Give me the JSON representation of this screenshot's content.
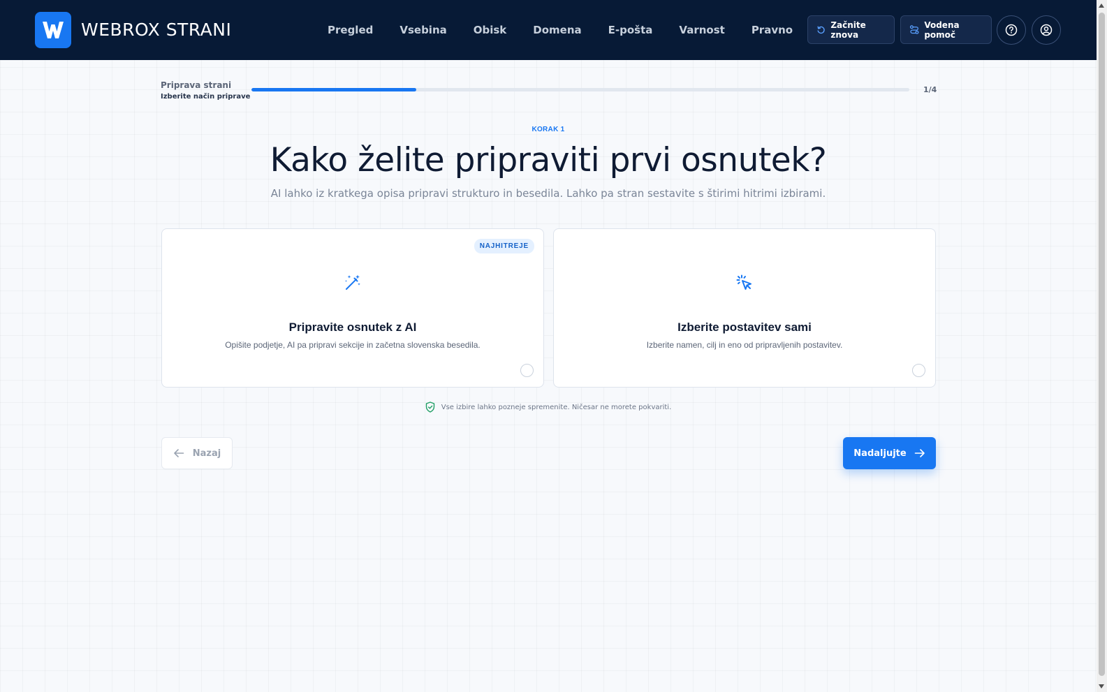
{
  "header": {
    "brand": "WEBROX STRANI",
    "logo_letter": "W",
    "nav": [
      "Pregled",
      "Vsebina",
      "Obisk",
      "Domena",
      "E-pošta",
      "Varnost",
      "Pravno"
    ],
    "restart_label": "Začnite znova",
    "guided_help_label": "Vodena pomoč",
    "help_icon": "question-circle-icon",
    "account_icon": "user-circle-icon"
  },
  "progress": {
    "title": "Priprava strani",
    "subtitle": "Izberite način priprave",
    "count": "1/4",
    "fraction": 0.25
  },
  "step": {
    "label": "KORAK 1",
    "headline": "Kako želite pripraviti prvi osnutek?",
    "subline": "AI lahko iz kratkega opisa pripravi strukturo in besedila. Lahko pa stran sestavite s štirimi hitrimi izbirami."
  },
  "options": [
    {
      "badge": "NAJHITREJE",
      "icon": "magic-wand-icon",
      "title": "Pripravite osnutek z AI",
      "description": "Opišite podjetje, AI pa pripravi sekcije in začetna slovenska besedila.",
      "selected": false
    },
    {
      "icon": "cursor-click-icon",
      "title": "Izberite postavitev sami",
      "description": "Izberite namen, cilj in eno od pripravljenih postavitev.",
      "selected": false
    }
  ],
  "notice": "Vse izbire lahko pozneje spremenite. Ničesar ne morete pokvariti.",
  "footer": {
    "back_label": "Nazaj",
    "next_label": "Nadaljujte"
  },
  "colors": {
    "header_bg": "#071a36",
    "accent": "#1877f2",
    "success": "#1e9e63"
  }
}
